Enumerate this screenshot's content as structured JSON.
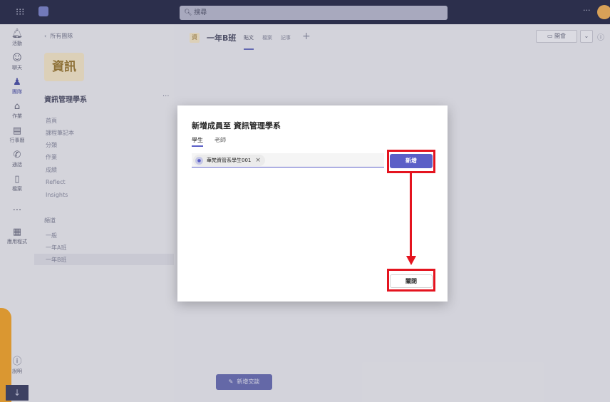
{
  "topbar": {
    "search_placeholder": "搜尋",
    "waffle_icon": "waffle-icon",
    "more": "···"
  },
  "rail": [
    {
      "icon": "bell-icon",
      "glyph": "🔔",
      "label": "活動"
    },
    {
      "icon": "chat-icon",
      "glyph": "💬",
      "label": "聊天"
    },
    {
      "icon": "teams-icon",
      "glyph": "👥",
      "label": "團隊"
    },
    {
      "icon": "backpack-icon",
      "glyph": "🎒",
      "label": "作業"
    },
    {
      "icon": "calendar-icon",
      "glyph": "📅",
      "label": "行事曆"
    },
    {
      "icon": "phone-icon",
      "glyph": "📞",
      "label": "通話"
    },
    {
      "icon": "file-icon",
      "glyph": "📄",
      "label": "檔案"
    },
    {
      "icon": "more-icon",
      "glyph": "···",
      "label": ""
    },
    {
      "icon": "apps-icon",
      "glyph": "▦",
      "label": "應用程式"
    },
    {
      "icon": "help-icon",
      "glyph": "?",
      "label": "說明"
    }
  ],
  "sidebar": {
    "back_label": "所有團隊",
    "team_tile": "資訊",
    "team_name": "資訊管理學系",
    "nav": [
      "首頁",
      "課程筆記本",
      "分類",
      "作業",
      "成績",
      "Reflect",
      "Insights"
    ],
    "section_title": "頻道",
    "channels": [
      "一般",
      "一年A班",
      "一年B班"
    ]
  },
  "channel_header": {
    "chip": "資",
    "title": "一年B班",
    "tabs": [
      "貼文",
      "檔案",
      "記事"
    ],
    "meet_label": "開會"
  },
  "new_conversation": "新增交談",
  "dialog": {
    "title": "新增成員至 資訊管理學系",
    "tabs": [
      "學生",
      "老師"
    ],
    "member_name": "華梵資管系學生001",
    "add_label": "新增",
    "close_label": "關閉"
  },
  "colors": {
    "accent": "#5b5fc7",
    "annotation": "#e4141f",
    "teams_bar": "#2c2f4d"
  }
}
